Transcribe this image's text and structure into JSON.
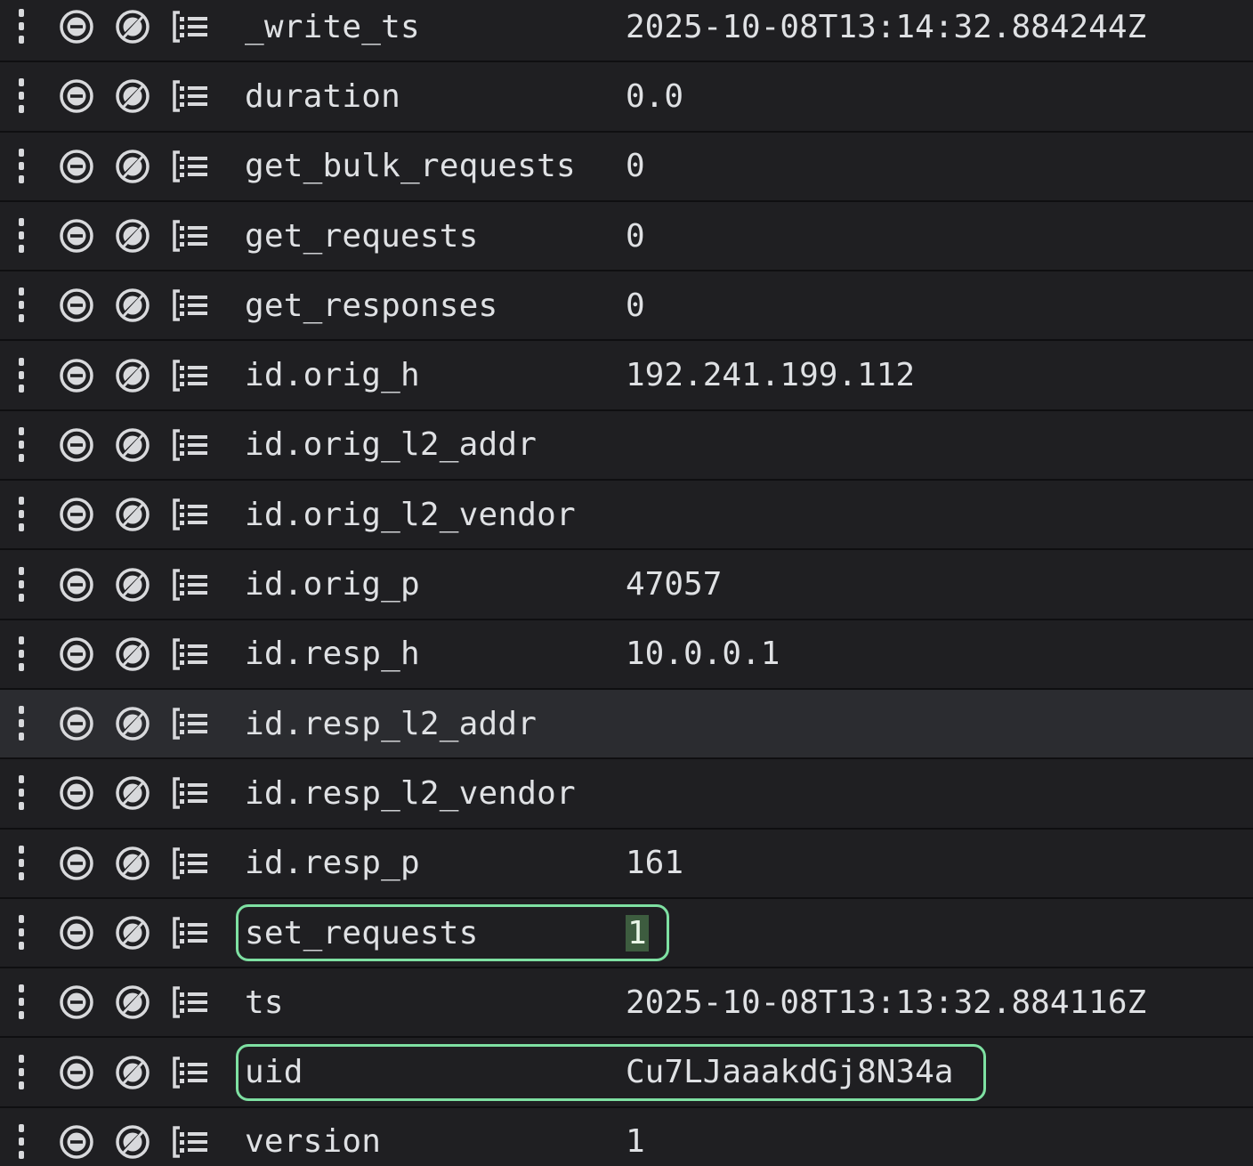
{
  "rows": [
    {
      "field": "_write_ts",
      "value": "2025-10-08T13:14:32.884244Z"
    },
    {
      "field": "duration",
      "value": "0.0"
    },
    {
      "field": "get_bulk_requests",
      "value": "0"
    },
    {
      "field": "get_requests",
      "value": "0"
    },
    {
      "field": "get_responses",
      "value": "0"
    },
    {
      "field": "id.orig_h",
      "value": "192.241.199.112"
    },
    {
      "field": "id.orig_l2_addr",
      "value": ""
    },
    {
      "field": "id.orig_l2_vendor",
      "value": ""
    },
    {
      "field": "id.orig_p",
      "value": "47057"
    },
    {
      "field": "id.resp_h",
      "value": "10.0.0.1"
    },
    {
      "field": "id.resp_l2_addr",
      "value": ""
    },
    {
      "field": "id.resp_l2_vendor",
      "value": ""
    },
    {
      "field": "id.resp_p",
      "value": "161"
    },
    {
      "field": "set_requests",
      "value": "1"
    },
    {
      "field": "ts",
      "value": "2025-10-08T13:13:32.884116Z"
    },
    {
      "field": "uid",
      "value": "Cu7LJaaakdGj8N34a"
    },
    {
      "field": "version",
      "value": "1"
    }
  ],
  "row_icons": [
    "drag-handle-icon",
    "filter-for-value-icon",
    "filter-out-value-icon",
    "toggle-column-icon"
  ],
  "hovered_row": "id.resp_l2_addr",
  "highlighted_rows": [
    "set_requests",
    "uid"
  ],
  "colors": {
    "background": "#1f1f22",
    "row_hover": "#2b2c30",
    "separator": "#0f0f11",
    "text": "#dfe1e4",
    "highlight_outline": "#7ee0a2",
    "selected_value_bg": "#3d5c3f"
  }
}
